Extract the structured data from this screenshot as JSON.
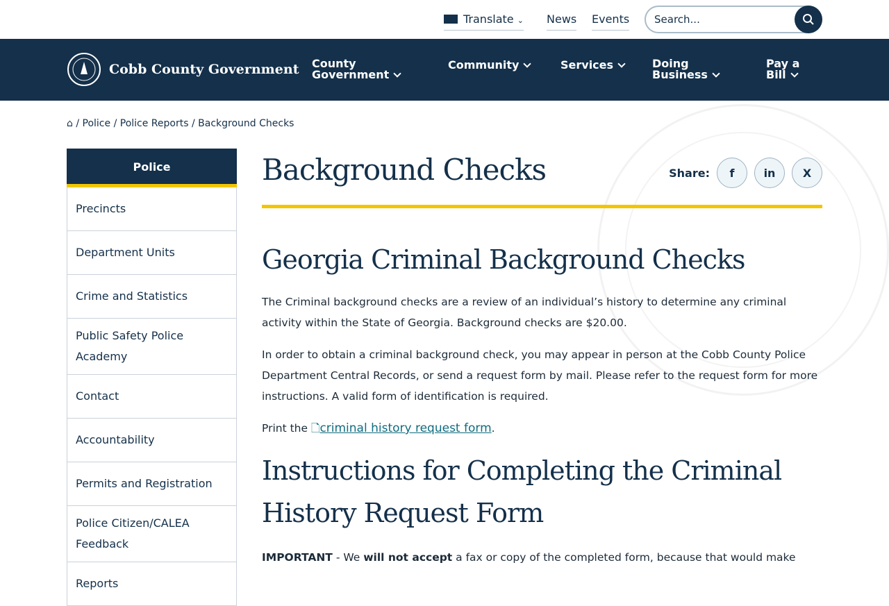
{
  "utility": {
    "translate": "Translate",
    "news": "News",
    "events": "Events",
    "search_placeholder": "Search..."
  },
  "nav": {
    "brand": "Cobb County Government",
    "items": [
      {
        "l1": "County",
        "l2": "Government"
      },
      {
        "l1": "Community",
        "l2": ""
      },
      {
        "l1": "Services",
        "l2": ""
      },
      {
        "l1": "Doing",
        "l2": "Business"
      },
      {
        "l1": "Pay a",
        "l2": "Bill"
      }
    ]
  },
  "breadcrumb": [
    "Police",
    "Police Reports",
    "Background Checks"
  ],
  "sidebar": {
    "title": "Police",
    "items": [
      "Precincts",
      "Department Units",
      "Crime and Statistics",
      "Public Safety Police Academy",
      "Contact",
      "Accountability",
      "Permits and Registration",
      "Police Citizen/CALEA Feedback",
      "Reports"
    ]
  },
  "main": {
    "title": "Background Checks",
    "share": "Share:",
    "share_icons": [
      "f",
      "in",
      "X"
    ],
    "h2a": "Georgia Criminal Background Checks",
    "p1": "The Criminal background checks are a review of an individual’s history to determine any criminal activity within the State of Georgia. Background checks are $20.00.",
    "p2": "In order to obtain a criminal background check, you may appear in person at the Cobb County Police Department Central Records, or send a request form by mail. Please refer to the request form for more instructions. A valid form of identification is required.",
    "p3_prefix": "Print the",
    "p3_link": "criminal history request form",
    "p3_suffix": ".",
    "h2b": "Instructions for Completing the Criminal History Request Form",
    "p4_bold": "IMPORTANT",
    "p4_a": " - We ",
    "p4_bold2": "will not accept",
    "p4_b": " a fax or copy of the completed form, because that would make"
  },
  "colors": {
    "navy": "#14304a",
    "accent": "#f2c500",
    "link": "#0e6c80"
  }
}
